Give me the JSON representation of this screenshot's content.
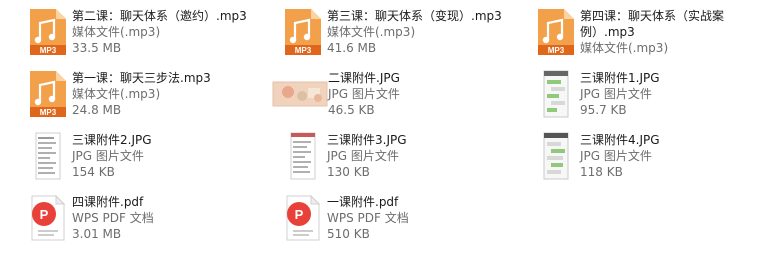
{
  "files": [
    {
      "name": "第二课：聊天体系（邀约）.mp3",
      "type": "媒体文件(.mp3)",
      "size": "33.5 MB",
      "icon": "mp3-file-icon"
    },
    {
      "name": "第三课：聊天体系（变现）.mp3",
      "type": "媒体文件(.mp3)",
      "size": "41.6 MB",
      "icon": "mp3-file-icon"
    },
    {
      "name": "第四课：聊天体系（实战案例）.mp3",
      "type": "媒体文件(.mp3)",
      "size": "",
      "icon": "mp3-file-icon"
    },
    {
      "name": "第一课：聊天三步法.mp3",
      "type": "媒体文件(.mp3)",
      "size": "24.8 MB",
      "icon": "mp3-file-icon"
    },
    {
      "name": "二课附件.JPG",
      "type": "JPG 图片文件",
      "size": "46.5 KB",
      "icon": "jpg-thumbnail-icon"
    },
    {
      "name": "三课附件1.JPG",
      "type": "JPG 图片文件",
      "size": "95.7 KB",
      "icon": "jpg-thumbnail-icon"
    },
    {
      "name": "三课附件2.JPG",
      "type": "JPG 图片文件",
      "size": "154 KB",
      "icon": "jpg-thumbnail-icon"
    },
    {
      "name": "三课附件3.JPG",
      "type": "JPG 图片文件",
      "size": "130 KB",
      "icon": "jpg-thumbnail-icon"
    },
    {
      "name": "三课附件4.JPG",
      "type": "JPG 图片文件",
      "size": "118 KB",
      "icon": "jpg-thumbnail-icon"
    },
    {
      "name": "四课附件.pdf",
      "type": "WPS PDF 文档",
      "size": "3.01 MB",
      "icon": "wps-pdf-icon"
    },
    {
      "name": "一课附件.pdf",
      "type": "WPS PDF 文档",
      "size": "510 KB",
      "icon": "wps-pdf-icon"
    }
  ],
  "colors": {
    "mp3_orange": "#f08a2a",
    "mp3_band": "#e0661c",
    "pdf_red": "#e8413a",
    "pdf_fold": "#f2f2f2",
    "text_primary": "#1a1a1a",
    "text_secondary": "#6d6d6d"
  }
}
